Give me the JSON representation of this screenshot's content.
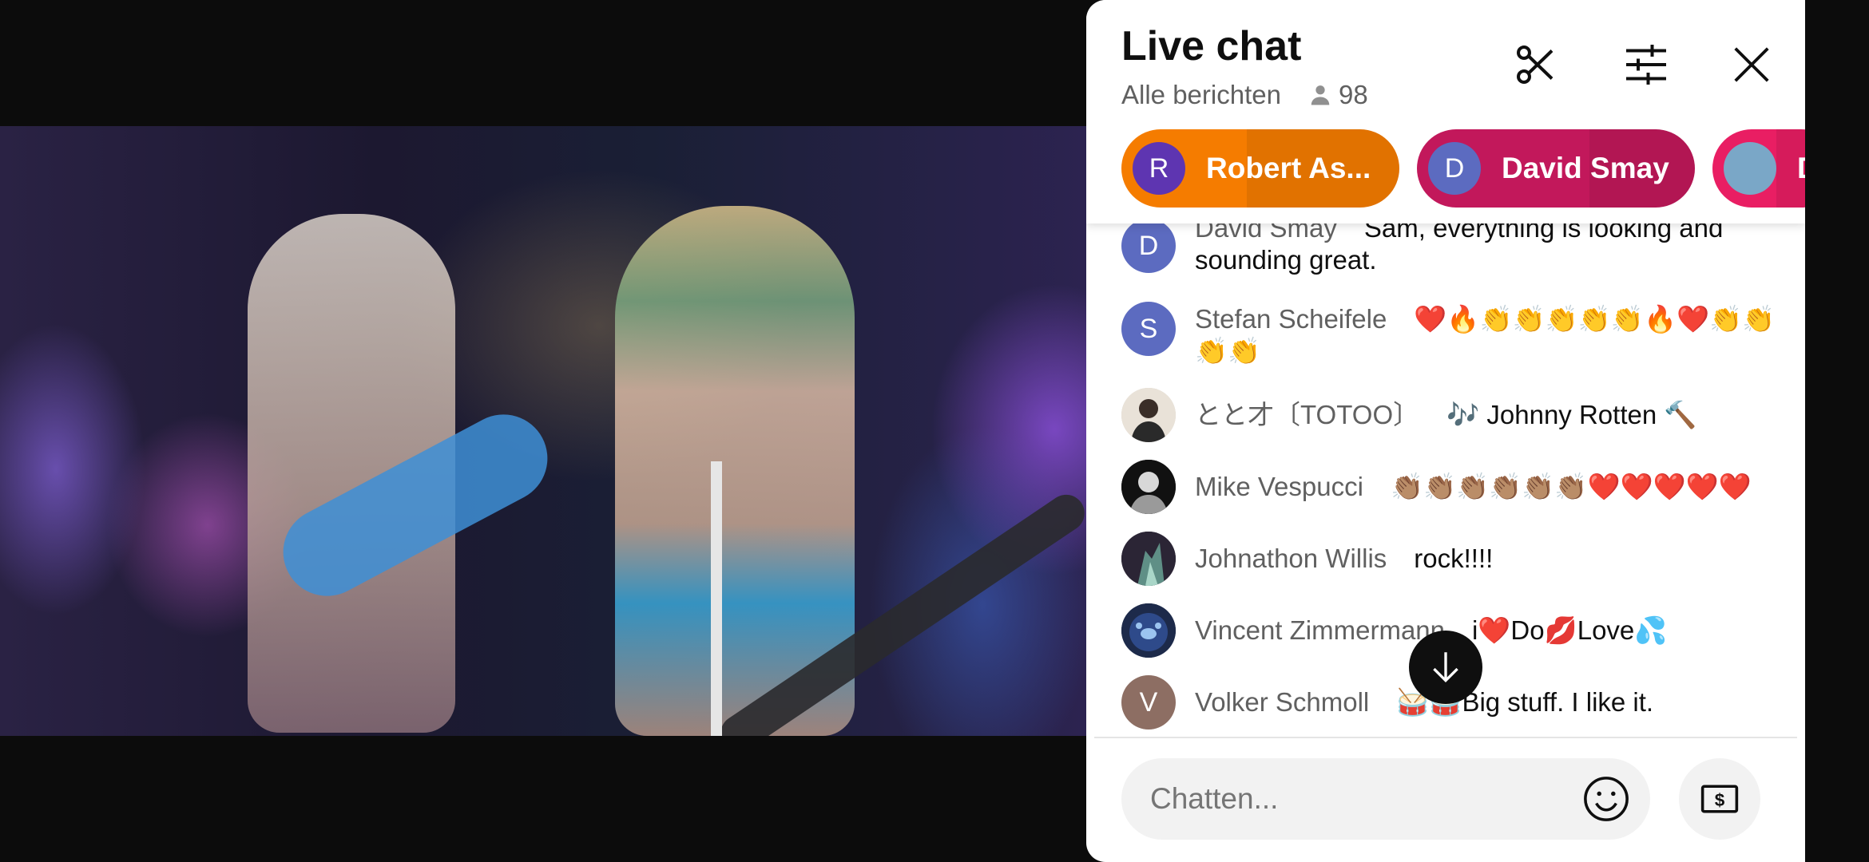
{
  "chat": {
    "title": "Live chat",
    "filter_label": "Alle berichten",
    "viewer_count": "98"
  },
  "tickers": [
    {
      "initial": "R",
      "name": "Robert As...",
      "bg": "#f57c00",
      "avatar_bg": "#5e35b1",
      "progress": 0.45
    },
    {
      "initial": "D",
      "name": "David Smay",
      "bg": "#c2185b",
      "avatar_bg": "#5c6bc0",
      "progress": 0.62
    },
    {
      "initial": "",
      "name": "D",
      "bg": "#e91e63",
      "avatar_bg": "#7aa7c7",
      "progress": 0.5
    }
  ],
  "messages": [
    {
      "author": "David Smay",
      "text": "Sam, everything is looking and sounding great.",
      "initial": "D",
      "avatar_bg": "#5c6bc0"
    },
    {
      "author": "Stefan Scheifele",
      "text": "❤️🔥👏👏👏👏👏🔥❤️👏👏👏👏",
      "initial": "S",
      "avatar_bg": "#5c6bc0"
    },
    {
      "author": "とと才〔TOTOO〕",
      "text": "🎶 Johnny Rotten 🔨",
      "initial": "",
      "avatar_bg": "#d8cfc4"
    },
    {
      "author": "Mike Vespucci",
      "text": "👏🏽👏🏽👏🏽👏🏽👏🏽👏🏽❤️❤️❤️❤️❤️",
      "initial": "",
      "avatar_bg": "#1a1a1a"
    },
    {
      "author": "Johnathon Willis",
      "text": "rock!!!!",
      "initial": "",
      "avatar_bg": "#2d2a3a"
    },
    {
      "author": "Vincent Zimmermann",
      "text": "i❤️Do💋Love💦",
      "initial": "",
      "avatar_bg": "#1d2a4a"
    },
    {
      "author": "Volker Schmoll",
      "text": "🥁🥁Big stuff. I like it.",
      "initial": "V",
      "avatar_bg": "#8d6e63"
    }
  ],
  "input": {
    "placeholder": "Chatten..."
  },
  "icons": {
    "clip": "scissors-icon",
    "filter": "sliders-icon",
    "close": "close-icon",
    "viewers": "person-icon",
    "emoji": "smiley-icon",
    "super_chat": "dollar-bill-icon",
    "scroll": "arrow-down-icon"
  }
}
